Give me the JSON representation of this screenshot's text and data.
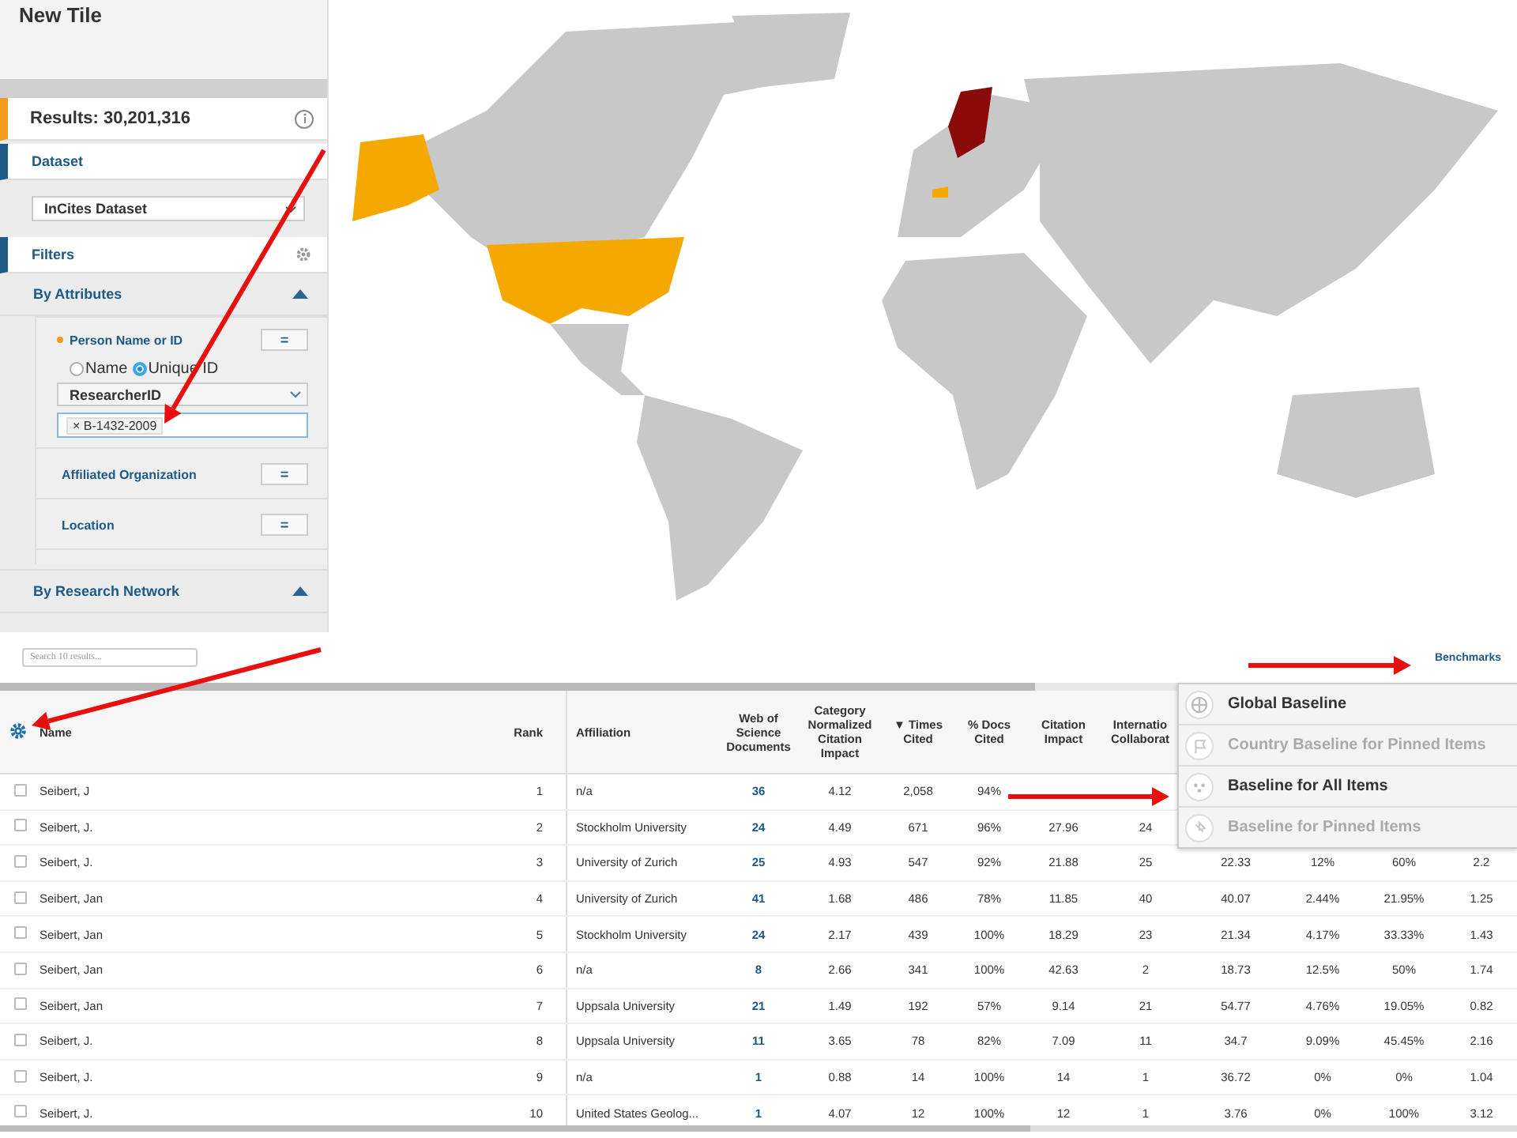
{
  "tile": {
    "title": "New Tile"
  },
  "sidebar": {
    "results": "Results: 30,201,316",
    "dataset": {
      "heading": "Dataset",
      "value": "InCites Dataset"
    },
    "filters": {
      "heading": "Filters"
    },
    "sections": [
      {
        "title": "By Attributes",
        "expanded": true
      },
      {
        "title": "By Research Network",
        "expanded": true
      }
    ],
    "attributes": [
      {
        "kind": "person",
        "label": "Person Name or ID",
        "operator": "=",
        "active": true,
        "options": [
          {
            "label": "Name",
            "selected": false
          },
          {
            "label": "Unique ID",
            "selected": true
          }
        ],
        "id_type": "ResearcherID",
        "tokens": [
          {
            "remove": "×",
            "label": "B-1432-2009"
          }
        ]
      },
      {
        "kind": "simple",
        "label": "Affiliated Organization",
        "operator": "="
      },
      {
        "kind": "simple",
        "label": "Location",
        "operator": "="
      }
    ]
  },
  "table": {
    "search": {
      "placeholder": "Search 10 results..."
    },
    "benchmarks": "Benchmarks",
    "columns": [
      {
        "label": "Name",
        "kind": "text"
      },
      {
        "label": "Rank",
        "kind": "text"
      },
      {
        "label": "Affiliation",
        "kind": "text"
      },
      {
        "label": "Web of Science Documents",
        "kind": "link"
      },
      {
        "label": "Category Normalized Citation Impact",
        "kind": "text"
      },
      {
        "label": "▼ Times Cited",
        "kind": "text"
      },
      {
        "label": "% Docs Cited",
        "kind": "text"
      },
      {
        "label": "Citation Impact",
        "kind": "text"
      },
      {
        "label": "Internatio Collaborat",
        "kind": "text"
      },
      {
        "kind": "text"
      },
      {
        "kind": "text"
      },
      {
        "kind": "text"
      },
      {
        "kind": "text"
      }
    ],
    "rows": [
      {
        "checked": false,
        "cells": [
          "Seibert, J",
          "1",
          "n/a",
          "36",
          "4.12",
          "2,058",
          "94%"
        ]
      },
      {
        "checked": false,
        "cells": [
          "Seibert, J.",
          "2",
          "Stockholm University",
          "24",
          "4.49",
          "671",
          "96%",
          "27.96",
          "24"
        ]
      },
      {
        "checked": false,
        "cells": [
          "Seibert, J.",
          "3",
          "University of Zurich",
          "25",
          "4.93",
          "547",
          "92%",
          "21.88",
          "25",
          "22.33",
          "12%",
          "60%",
          "2.2"
        ]
      },
      {
        "checked": false,
        "cells": [
          "Seibert, Jan",
          "4",
          "University of Zurich",
          "41",
          "1.68",
          "486",
          "78%",
          "11.85",
          "40",
          "40.07",
          "2.44%",
          "21.95%",
          "1.25"
        ]
      },
      {
        "checked": false,
        "cells": [
          "Seibert, Jan",
          "5",
          "Stockholm University",
          "24",
          "2.17",
          "439",
          "100%",
          "18.29",
          "23",
          "21.34",
          "4.17%",
          "33.33%",
          "1.43"
        ]
      },
      {
        "checked": false,
        "cells": [
          "Seibert, Jan",
          "6",
          "n/a",
          "8",
          "2.66",
          "341",
          "100%",
          "42.63",
          "2",
          "18.73",
          "12.5%",
          "50%",
          "1.74"
        ]
      },
      {
        "checked": false,
        "cells": [
          "Seibert, Jan",
          "7",
          "Uppsala University",
          "21",
          "1.49",
          "192",
          "57%",
          "9.14",
          "21",
          "54.77",
          "4.76%",
          "19.05%",
          "0.82"
        ]
      },
      {
        "checked": false,
        "cells": [
          "Seibert, J.",
          "8",
          "Uppsala University",
          "11",
          "3.65",
          "78",
          "82%",
          "7.09",
          "11",
          "34.7",
          "9.09%",
          "45.45%",
          "2.16"
        ]
      },
      {
        "checked": false,
        "cells": [
          "Seibert, J.",
          "9",
          "n/a",
          "1",
          "0.88",
          "14",
          "100%",
          "14",
          "1",
          "36.72",
          "0%",
          "0%",
          "1.04"
        ]
      },
      {
        "checked": false,
        "cells": [
          "Seibert, J.",
          "10",
          "United States Geolog...",
          "1",
          "4.07",
          "12",
          "100%",
          "12",
          "1",
          "3.76",
          "0%",
          "100%",
          "3.12"
        ]
      }
    ]
  },
  "benchmark_menu": [
    {
      "kind": "globe",
      "label": "Global Baseline",
      "disabled": false
    },
    {
      "kind": "flag",
      "label": "Country Baseline for Pinned Items",
      "disabled": true
    },
    {
      "kind": "dots",
      "label": "Baseline for All Items",
      "disabled": false
    },
    {
      "kind": "pin",
      "label": "Baseline for Pinned Items",
      "disabled": true
    }
  ]
}
